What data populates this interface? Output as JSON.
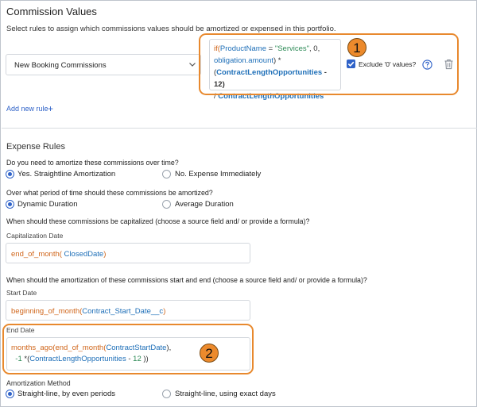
{
  "commission": {
    "title": "Commission Values",
    "description": "Select rules to assign which commissions values should be amortized or expensed in this portfolio.",
    "rule_select": "New Booking Commissions",
    "formula": {
      "l1_fn": "if(",
      "l1_field": "ProductName",
      "l1_op": " = ",
      "l1_str": "\"Services\"",
      "l1_tail": ", 0,",
      "l2_field": "obligation.amount",
      "l2_op": ") *",
      "l3_open": "(",
      "l3_field": "ContractLengthOpportunities",
      "l3_tail": " - 12)",
      "l4_op": "/ ",
      "l4_field": "ContractLengthOpportunities"
    },
    "exclude_label": "Exclude '0' values?",
    "add_rule": "Add new rule",
    "add_plus": "+"
  },
  "callouts": {
    "one": "1",
    "two": "2"
  },
  "expense": {
    "title": "Expense Rules",
    "q_amortize": "Do you need to amortize these commissions over time?",
    "opt_straightline": "Yes. Straightline Amortization",
    "opt_expense": "No. Expense Immediately",
    "q_period": "Over what period of time should these commissions be amortized?",
    "opt_dynamic": "Dynamic Duration",
    "opt_average": "Average Duration",
    "q_capitalized": "When should these commissions be capitalized (choose a source field and/ or provide a formula)?",
    "cap_label": "Capitalization Date",
    "cap_fn": "end_of_month(",
    "cap_field": " ClosedDate",
    "cap_close": ")",
    "q_start_end": "When should the amortization of these commissions start and end (choose a source field and/ or provide a formula)?",
    "start_label": "Start Date",
    "start_fn": "beginning_of_month(",
    "start_field": "Contract_Start_Date__c",
    "start_close": ")",
    "end_label": "End Date",
    "end_fn1": "months_ago(",
    "end_fn2": "end_of_month(",
    "end_field": "ContractStartDate",
    "end_l1_tail": "),",
    "end_l2_num": "-1",
    "end_l2_mid": " *(",
    "end_l2_field": "ContractLengthOpportunities",
    "end_l2_op": "  - ",
    "end_l2_num2": "12",
    "end_l2_close": " ))",
    "method_label": "Amortization Method",
    "opt_even": "Straight-line, by even periods",
    "opt_exact": "Straight-line, using exact days"
  },
  "colors": {
    "accent": "#2f62c8",
    "callout": "#e8892e",
    "function": "#d0661b",
    "field": "#1e6fb8",
    "string": "#2e8b57"
  }
}
